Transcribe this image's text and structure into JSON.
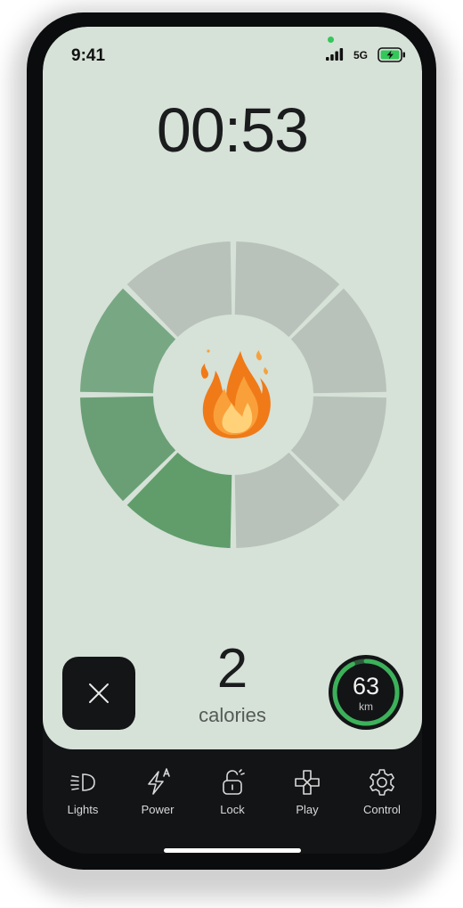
{
  "status_bar": {
    "time": "9:41",
    "network": "5G"
  },
  "workout": {
    "timer": "00:53",
    "calories_value": "2",
    "calories_label": "calories",
    "distance_value": "63",
    "distance_unit": "km",
    "progress_segments_filled": 3,
    "progress_segments_total": 8
  },
  "colors": {
    "panel_bg": "#d6e1d7",
    "segment_active": "#6fa17a",
    "segment_inactive": "#b9c2ba",
    "accent_green": "#3cb15a"
  },
  "nav": {
    "items": [
      {
        "label": "Lights",
        "icon": "headlight-icon"
      },
      {
        "label": "Power",
        "icon": "lightning-auto-icon"
      },
      {
        "label": "Lock",
        "icon": "unlock-icon"
      },
      {
        "label": "Play",
        "icon": "gamepad-icon"
      },
      {
        "label": "Control",
        "icon": "gear-icon"
      }
    ]
  },
  "close_button": {
    "icon": "close-icon"
  },
  "center_icon": "fire-icon"
}
